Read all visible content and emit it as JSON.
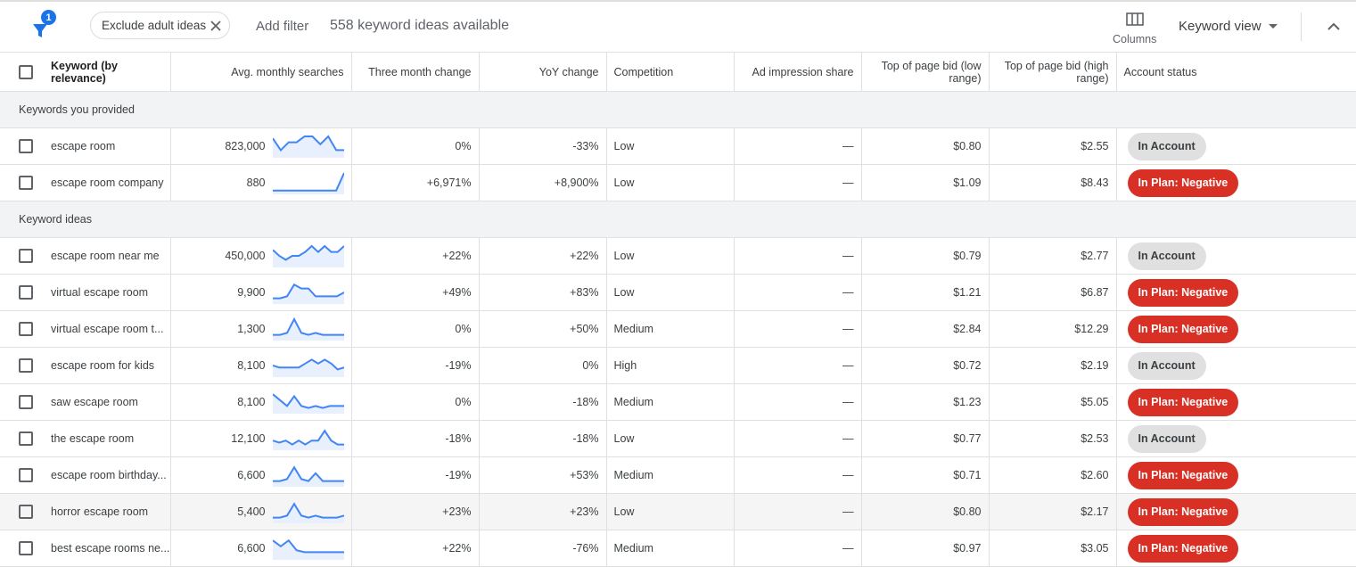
{
  "toolbar": {
    "filter_badge": "1",
    "chip_label": "Exclude adult ideas",
    "add_filter": "Add filter",
    "ideas_count": "558 keyword ideas available",
    "columns_label": "Columns",
    "view_label": "Keyword view"
  },
  "columns": {
    "keyword": "Keyword (by relevance)",
    "searches": "Avg. monthly searches",
    "three_month": "Three month change",
    "yoy": "YoY change",
    "competition": "Competition",
    "impression": "Ad impression share",
    "bid_low": "Top of page bid (low range)",
    "bid_high": "Top of page bid (high range)",
    "status": "Account status"
  },
  "groups": {
    "provided": "Keywords you provided",
    "ideas": "Keyword ideas"
  },
  "colors": {
    "accent": "#1a73e8",
    "negative": "#d93025",
    "spark_line": "#4285f4",
    "spark_fill": "#e8f0fe"
  },
  "rows": [
    {
      "keyword": "escape room",
      "searches": "823,000",
      "trend": [
        9,
        3,
        7,
        7,
        10,
        10,
        6,
        10,
        3,
        3
      ],
      "three_month": "0%",
      "yoy": "-33%",
      "competition": "Low",
      "impression": "—",
      "bid_low": "$0.80",
      "bid_high": "$2.55",
      "status": "In Account"
    },
    {
      "keyword": "escape room company",
      "searches": "880",
      "trend": [
        1,
        1,
        1,
        1,
        1,
        1,
        1,
        1,
        1,
        10
      ],
      "three_month": "+6,971%",
      "yoy": "+8,900%",
      "competition": "Low",
      "impression": "—",
      "bid_low": "$1.09",
      "bid_high": "$8.43",
      "status": "In Plan: Negative"
    },
    {
      "keyword": "escape room near me",
      "searches": "450,000",
      "trend": [
        8,
        5,
        3,
        5,
        5,
        7,
        10,
        7,
        10,
        7,
        7,
        10
      ],
      "three_month": "+22%",
      "yoy": "+22%",
      "competition": "Low",
      "impression": "—",
      "bid_low": "$0.79",
      "bid_high": "$2.77",
      "status": "In Account"
    },
    {
      "keyword": "virtual escape room",
      "searches": "9,900",
      "trend": [
        2,
        2,
        3,
        9,
        7,
        7,
        3,
        3,
        3,
        3,
        5
      ],
      "three_month": "+49%",
      "yoy": "+83%",
      "competition": "Low",
      "impression": "—",
      "bid_low": "$1.21",
      "bid_high": "$6.87",
      "status": "In Plan: Negative"
    },
    {
      "keyword": "virtual escape room t...",
      "searches": "1,300",
      "trend": [
        2,
        2,
        3,
        10,
        3,
        2,
        3,
        2,
        2,
        2,
        2
      ],
      "three_month": "0%",
      "yoy": "+50%",
      "competition": "Medium",
      "impression": "—",
      "bid_low": "$2.84",
      "bid_high": "$12.29",
      "status": "In Plan: Negative"
    },
    {
      "keyword": "escape room for kids",
      "searches": "8,100",
      "trend": [
        5,
        4,
        4,
        4,
        4,
        6,
        8,
        6,
        8,
        6,
        3,
        4
      ],
      "three_month": "-19%",
      "yoy": "0%",
      "competition": "High",
      "impression": "—",
      "bid_low": "$0.72",
      "bid_high": "$2.19",
      "status": "In Account"
    },
    {
      "keyword": "saw escape room",
      "searches": "8,100",
      "trend": [
        9,
        6,
        3,
        8,
        3,
        2,
        3,
        2,
        3,
        3,
        3
      ],
      "three_month": "0%",
      "yoy": "-18%",
      "competition": "Medium",
      "impression": "—",
      "bid_low": "$1.23",
      "bid_high": "$5.05",
      "status": "In Plan: Negative"
    },
    {
      "keyword": "the escape room",
      "searches": "12,100",
      "trend": [
        4,
        3,
        4,
        2,
        4,
        2,
        4,
        4,
        9,
        4,
        2,
        2
      ],
      "three_month": "-18%",
      "yoy": "-18%",
      "competition": "Low",
      "impression": "—",
      "bid_low": "$0.77",
      "bid_high": "$2.53",
      "status": "In Account"
    },
    {
      "keyword": "escape room birthday...",
      "searches": "6,600",
      "trend": [
        2,
        2,
        3,
        9,
        3,
        2,
        6,
        2,
        2,
        2,
        2
      ],
      "three_month": "-19%",
      "yoy": "+53%",
      "competition": "Medium",
      "impression": "—",
      "bid_low": "$0.71",
      "bid_high": "$2.60",
      "status": "In Plan: Negative"
    },
    {
      "keyword": "horror escape room",
      "searches": "5,400",
      "trend": [
        2,
        2,
        3,
        9,
        3,
        2,
        3,
        2,
        2,
        2,
        3
      ],
      "three_month": "+23%",
      "yoy": "+23%",
      "competition": "Low",
      "impression": "—",
      "bid_low": "$0.80",
      "bid_high": "$2.17",
      "status": "In Plan: Negative"
    },
    {
      "keyword": "best escape rooms ne...",
      "searches": "6,600",
      "trend": [
        9,
        6,
        9,
        4,
        3,
        3,
        3,
        3,
        3,
        3
      ],
      "three_month": "+22%",
      "yoy": "-76%",
      "competition": "Medium",
      "impression": "—",
      "bid_low": "$0.97",
      "bid_high": "$3.05",
      "status": "In Plan: Negative"
    }
  ]
}
